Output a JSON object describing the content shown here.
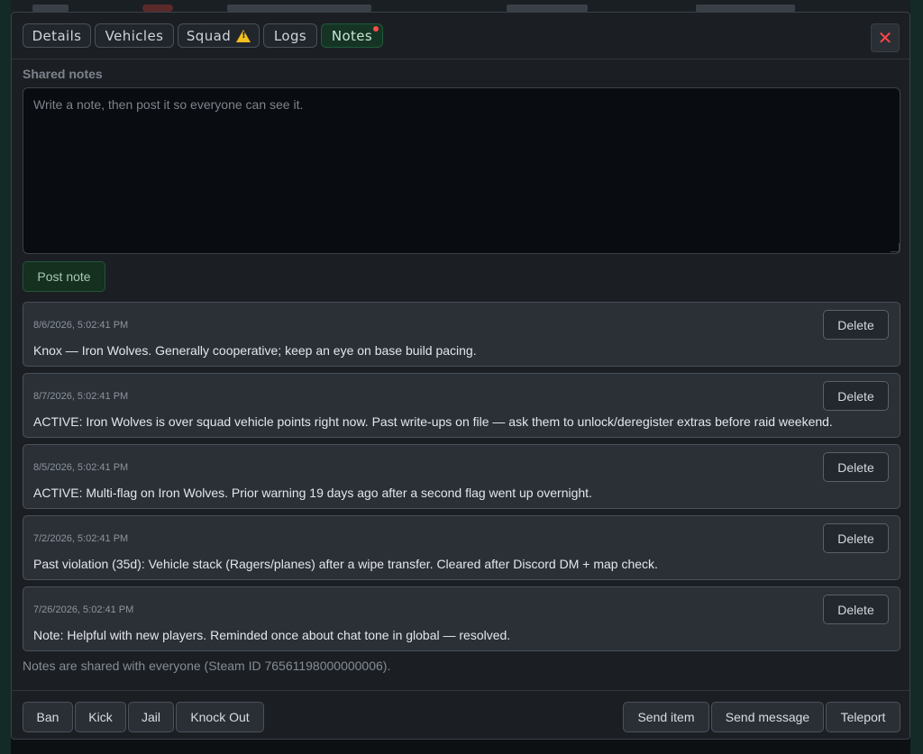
{
  "tabs": [
    {
      "label": "Details",
      "active": false
    },
    {
      "label": "Vehicles",
      "active": false
    },
    {
      "label": "Squad",
      "active": false,
      "icon": "warning-icon"
    },
    {
      "label": "Logs",
      "active": false
    },
    {
      "label": "Notes",
      "active": true,
      "badge": "red-dot"
    }
  ],
  "close_label": "✕",
  "notes_section": {
    "label": "Shared notes",
    "placeholder": "Write a note, then post it so everyone can see it.",
    "value": "",
    "post_label": "Post note"
  },
  "notes": [
    {
      "time": "8/6/2026, 5:02:41 PM",
      "text": "Knox — Iron Wolves. Generally cooperative; keep an eye on base build pacing.",
      "delete_label": "Delete"
    },
    {
      "time": "8/7/2026, 5:02:41 PM",
      "text": "ACTIVE: Iron Wolves is over squad vehicle points right now. Past write-ups on file — ask them to unlock/deregister extras before raid weekend.",
      "delete_label": "Delete"
    },
    {
      "time": "8/5/2026, 5:02:41 PM",
      "text": "ACTIVE: Multi-flag on Iron Wolves. Prior warning 19 days ago after a second flag went up overnight.",
      "delete_label": "Delete"
    },
    {
      "time": "7/2/2026, 5:02:41 PM",
      "text": "Past violation (35d): Vehicle stack (Ragers/planes) after a wipe transfer. Cleared after Discord DM + map check.",
      "delete_label": "Delete"
    },
    {
      "time": "7/26/2026, 5:02:41 PM",
      "text": "Note: Helpful with new players. Reminded once about chat tone in global — resolved.",
      "delete_label": "Delete"
    }
  ],
  "footnote": "Notes are shared with everyone (Steam ID 76561198000000006).",
  "actions_left": [
    "Ban",
    "Kick",
    "Jail",
    "Knock Out"
  ],
  "actions_right": [
    "Send item",
    "Send message",
    "Teleport"
  ],
  "colors": {
    "accent_green": "#163424",
    "close_red": "#ff4747",
    "warning_yellow": "#f2c01e"
  }
}
